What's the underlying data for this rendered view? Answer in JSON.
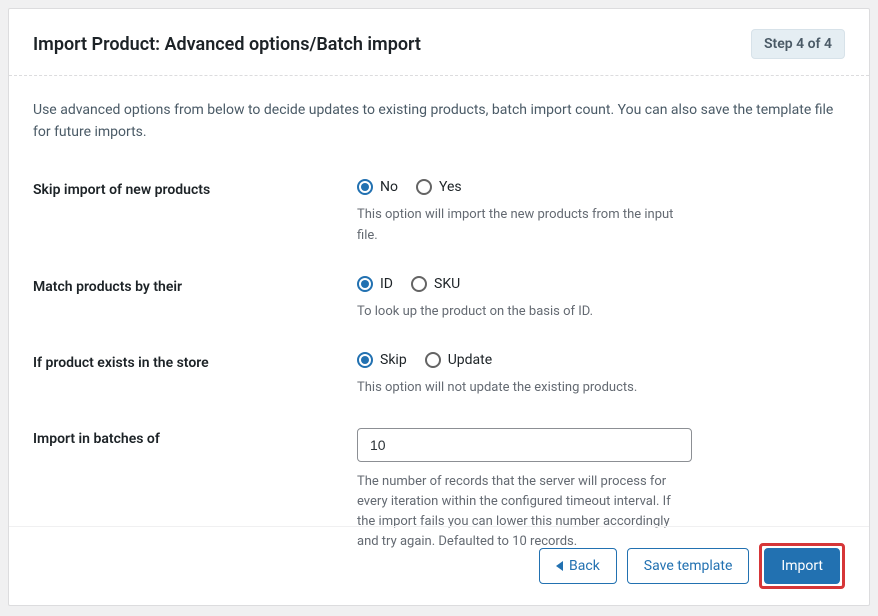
{
  "header": {
    "title": "Import Product: Advanced options/Batch import",
    "step_badge": "Step 4 of 4"
  },
  "description": "Use advanced options from below to decide updates to existing products, batch import count. You can also save the template file for future imports.",
  "fields": {
    "skip_new": {
      "label": "Skip import of new products",
      "option_no": "No",
      "option_yes": "Yes",
      "helper": "This option will import the new products from the input file."
    },
    "match_by": {
      "label": "Match products by their",
      "option_id": "ID",
      "option_sku": "SKU",
      "helper": "To look up the product on the basis of ID."
    },
    "if_exists": {
      "label": "If product exists in the store",
      "option_skip": "Skip",
      "option_update": "Update",
      "helper": "This option will not update the existing products."
    },
    "batch_size": {
      "label": "Import in batches of",
      "value": "10",
      "helper": "The number of records that the server will process for every iteration within the configured timeout interval. If the import fails you can lower this number accordingly and try again. Defaulted to 10 records."
    }
  },
  "footer": {
    "back": "Back",
    "save_template": "Save template",
    "import": "Import"
  }
}
